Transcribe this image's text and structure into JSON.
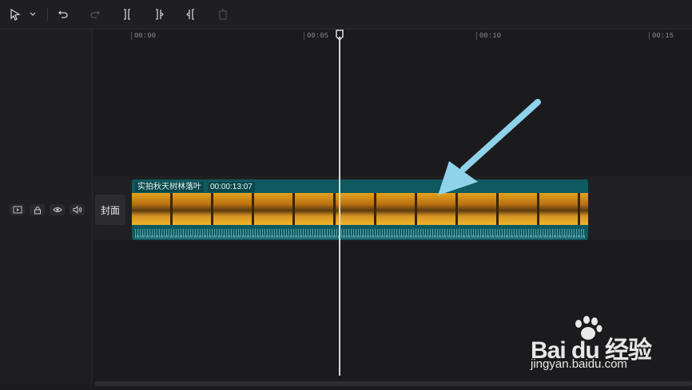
{
  "toolbar": {
    "tools": [
      "select-pointer",
      "dropdown",
      "undo",
      "redo",
      "split",
      "split-left",
      "split-right",
      "delete"
    ]
  },
  "ruler": {
    "labels": [
      "00:00",
      "00:05",
      "00:10",
      "00:15"
    ]
  },
  "track": {
    "cover_label": "封面",
    "icons": [
      "video-track-icon",
      "lock-icon",
      "eye-icon",
      "volume-icon"
    ]
  },
  "clip": {
    "title": "实拍秋天树林落叶",
    "duration": "00:00:13:07"
  },
  "watermark": {
    "brand": "Bai du 经验",
    "url": "jingyan.baidu.com"
  },
  "colors": {
    "accent": "#0e5a60",
    "arrow": "#8fd3ea",
    "background": "#1b1b1d"
  }
}
